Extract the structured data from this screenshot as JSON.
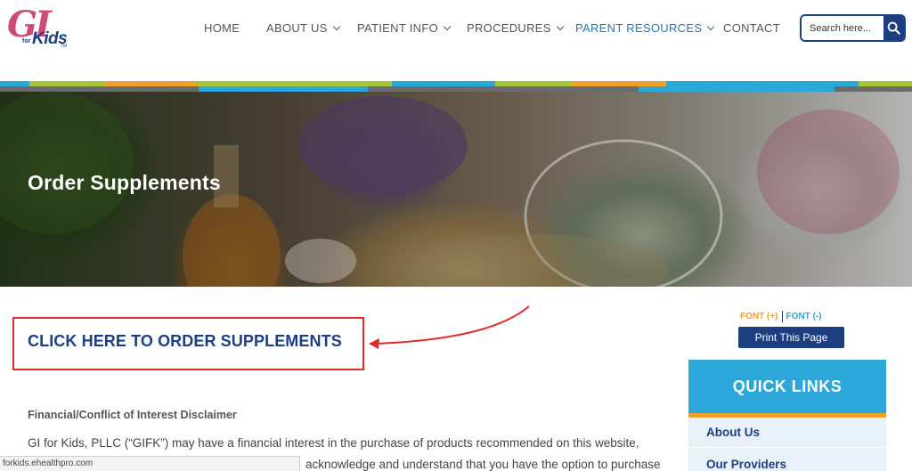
{
  "logo": {
    "main": "GI",
    "for": "for",
    "kids": "Kids",
    "tm": "TM"
  },
  "nav": {
    "items": [
      {
        "label": "HOME",
        "dropdown": false,
        "active": false
      },
      {
        "label": "ABOUT US",
        "dropdown": true,
        "active": false
      },
      {
        "label": "PATIENT INFO",
        "dropdown": true,
        "active": false
      },
      {
        "label": "PROCEDURES",
        "dropdown": true,
        "active": false
      },
      {
        "label": "PARENT RESOURCES",
        "dropdown": true,
        "active": true
      },
      {
        "label": "CONTACT",
        "dropdown": false,
        "active": false
      }
    ]
  },
  "search": {
    "placeholder": "Search here...",
    "icon": "search-icon"
  },
  "banner": {
    "title": "Order Supplements"
  },
  "content": {
    "cta_link": "CLICK HERE TO ORDER SUPPLEMENTS",
    "disclaimer_title": "Financial/Conflict of Interest Disclaimer",
    "paragraph_line1": "GI for Kids, PLLC (“GIFK”) may have a financial interest in the purchase of products recommended on this website,",
    "paragraph_line2": "acknowledge and understand that you have the option to purchase"
  },
  "sidebar": {
    "font_increase": "FONT (+)",
    "font_decrease": "FONT (-)",
    "print_label": "Print This Page",
    "quick_links_title": "QUICK LINKS",
    "quick_links": [
      "About Us",
      "Our Providers"
    ]
  },
  "status_bar": {
    "url": "forkids.ehealthpro.com"
  },
  "colors": {
    "navy": "#1d3f82",
    "sky_blue": "#2da6d9",
    "orange": "#f1a12a",
    "lime": "#a6c83a",
    "gray": "#6b6b6b",
    "red_annotation": "#e02a2a",
    "pink_logo": "#d04a78"
  }
}
